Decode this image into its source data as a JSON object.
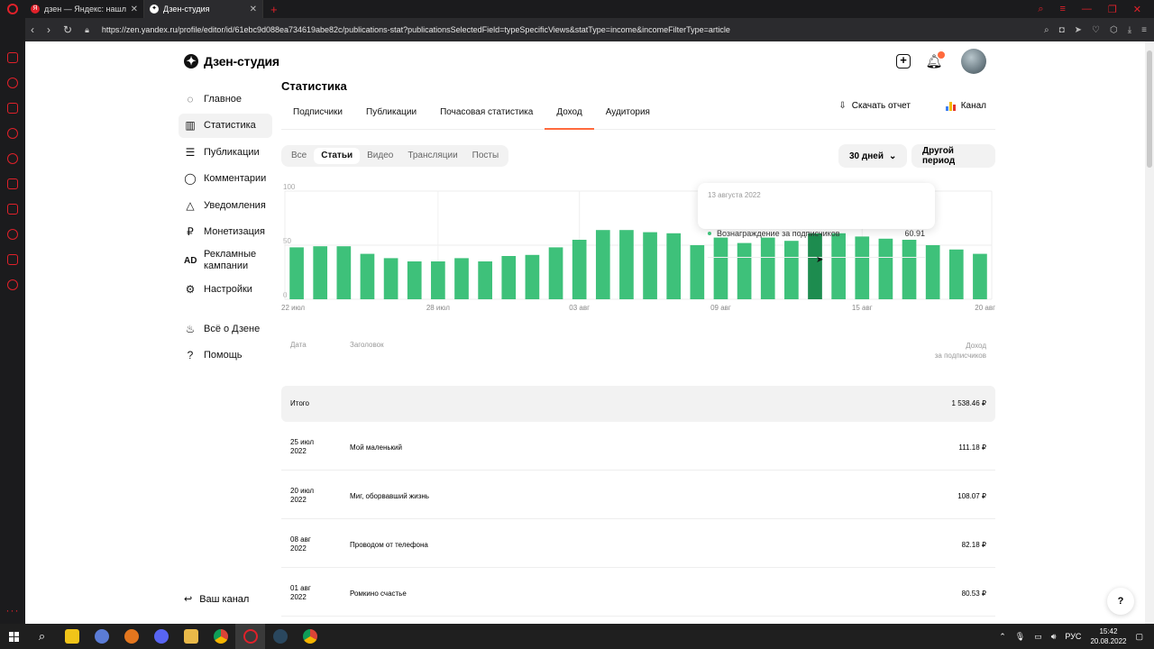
{
  "browser": {
    "tabs": [
      {
        "title": "дзен — Яндекс: нашлось",
        "favicon": "Я",
        "active": false
      },
      {
        "title": "Дзен-студия",
        "favicon": "✦",
        "active": true
      }
    ],
    "url": "https://zen.yandex.ru/profile/editor/id/61ebc9d088ea734619abe82c/publications-stat?publicationsSelectedField=typeSpecificViews&statType=income&incomeFilterType=article"
  },
  "header": {
    "brand": "Дзен-студия"
  },
  "sidebar": {
    "items": [
      {
        "label": "Главное",
        "icon": "planet-icon",
        "glyph": "◌"
      },
      {
        "label": "Статистика",
        "icon": "bar-chart-icon",
        "glyph": "▥",
        "active": true
      },
      {
        "label": "Публикации",
        "icon": "stack-icon",
        "glyph": "☰"
      },
      {
        "label": "Комментарии",
        "icon": "comment-icon",
        "glyph": "◯"
      },
      {
        "label": "Уведомления",
        "icon": "bell-icon",
        "glyph": "△"
      },
      {
        "label": "Монетизация",
        "icon": "ruble-icon",
        "glyph": "₽"
      },
      {
        "label": "Рекламные кампании",
        "icon": "ad-icon",
        "glyph": "AD"
      },
      {
        "label": "Настройки",
        "icon": "gear-icon",
        "glyph": "⚙"
      }
    ],
    "secondary": [
      {
        "label": "Всё о Дзене",
        "icon": "fire-icon",
        "glyph": "♨"
      },
      {
        "label": "Помощь",
        "icon": "help-icon",
        "glyph": "?"
      }
    ],
    "your_channel": "Ваш канал"
  },
  "main": {
    "title": "Статистика",
    "tabs": [
      "Подписчики",
      "Публикации",
      "Почасовая статистика",
      "Доход",
      "Аудитория"
    ],
    "active_tab": "Доход",
    "download_report": "Скачать отчет",
    "channel": "Канал",
    "filters": [
      "Все",
      "Статьи",
      "Видео",
      "Трансляции",
      "Посты"
    ],
    "active_filter": "Статьи",
    "period": "30 дней",
    "other_period": "Другой период"
  },
  "chart_data": {
    "type": "bar",
    "categories": [
      "22 июл",
      "23 июл",
      "24 июл",
      "25 июл",
      "26 июл",
      "27 июл",
      "28 июл",
      "29 июл",
      "30 июл",
      "31 июл",
      "01 авг",
      "02 авг",
      "03 авг",
      "04 авг",
      "05 авг",
      "06 авг",
      "07 авг",
      "08 авг",
      "09 авг",
      "10 авг",
      "11 авг",
      "12 авг",
      "13 авг",
      "14 авг",
      "15 авг",
      "16 авг",
      "17 авг",
      "18 авг",
      "19 авг",
      "20 авг"
    ],
    "x_tick_labels": [
      "22 июл",
      "28 июл",
      "03 авг",
      "09 авг",
      "15 авг",
      "20 авг"
    ],
    "values": [
      48,
      49,
      49,
      42,
      38,
      35,
      35,
      38,
      35,
      40,
      41,
      48,
      55,
      64,
      64,
      62,
      61,
      50,
      57,
      52,
      57,
      54,
      60.91,
      61,
      58,
      56,
      55,
      50,
      46,
      42
    ],
    "highlight_index": 22,
    "ylim": [
      0,
      100
    ],
    "y_ticks": [
      0,
      50,
      100
    ],
    "grid": true,
    "color": "#3ec17a",
    "highlight_color": "#1d8c4f"
  },
  "tooltip": {
    "date": "13 августа 2022",
    "label": "Вознаграждение за подписчиков",
    "value": "60.91"
  },
  "table": {
    "col_date": "Дата",
    "col_title": "Заголовок",
    "col_income": "Доход",
    "col_income_sub": "за подписчиков",
    "total_label": "Итого",
    "total_value": "1 538.46 ₽",
    "rows": [
      {
        "date": "25 июл 2022",
        "title": "Мой маленький",
        "amount": "111.18 ₽"
      },
      {
        "date": "20 июл 2022",
        "title": "Миг, оборвавший жизнь",
        "amount": "108.07 ₽"
      },
      {
        "date": "08 авг 2022",
        "title": "Проводом от телефона",
        "amount": "82.18 ₽"
      },
      {
        "date": "01 авг 2022",
        "title": "Ромкино счастье",
        "amount": "80.53 ₽"
      }
    ]
  },
  "help_button": "?",
  "taskbar": {
    "lang": "РУС",
    "time": "15:42",
    "date": "20.08.2022"
  }
}
